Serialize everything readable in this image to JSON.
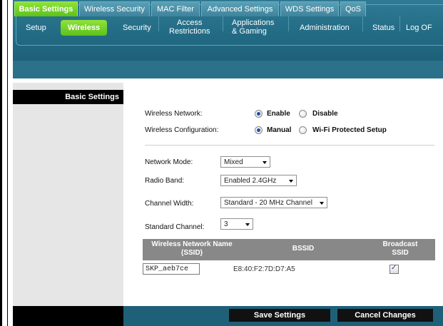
{
  "nav": {
    "items": [
      {
        "label": "Setup"
      },
      {
        "label": "Wireless"
      },
      {
        "label": "Security"
      },
      {
        "label": "Access\nRestrictions"
      },
      {
        "label": "Applications\n& Gaming"
      },
      {
        "label": "Administration"
      },
      {
        "label": "Status"
      },
      {
        "label": "Log OF"
      }
    ],
    "active": "Wireless"
  },
  "tabs": [
    {
      "label": "Basic Settings"
    },
    {
      "label": "Wireless Security"
    },
    {
      "label": "MAC Filter"
    },
    {
      "label": "Advanced Settings"
    },
    {
      "label": "WDS Settings"
    },
    {
      "label": "QoS"
    }
  ],
  "sidebar": {
    "title": "Basic Settings"
  },
  "form": {
    "wireless_network_label": "Wireless Network:",
    "enable_label": "Enable",
    "disable_label": "Disable",
    "wireless_config_label": "Wireless Configuration:",
    "manual_label": "Manual",
    "wps_label": "Wi-Fi Protected Setup",
    "network_mode_label": "Network Mode:",
    "network_mode_value": "Mixed",
    "radio_band_label": "Radio Band:",
    "radio_band_value": "Enabled 2.4GHz",
    "channel_width_label": "Channel Width:",
    "channel_width_value": "Standard - 20 MHz Channel",
    "standard_channel_label": "Standard Channel:",
    "standard_channel_value": "3"
  },
  "table": {
    "col_ssid_line1": "Wireless Network Name",
    "col_ssid_line2": "(SSID)",
    "col_bssid": "BSSID",
    "col_broadcast_line1": "Broadcast",
    "col_broadcast_line2": "SSID",
    "ssid_value": "SKP_aeb7ce",
    "bssid_value": "E8:40:F2:7D:D7:A5",
    "broadcast_checked": true
  },
  "buttons": {
    "save": "Save Settings",
    "cancel": "Cancel Changes"
  },
  "colors": {
    "nav_bg": "#226a84",
    "active_green": "#5cc21a",
    "sidebar_bg": "#e6e6e6",
    "table_head": "#888888"
  }
}
